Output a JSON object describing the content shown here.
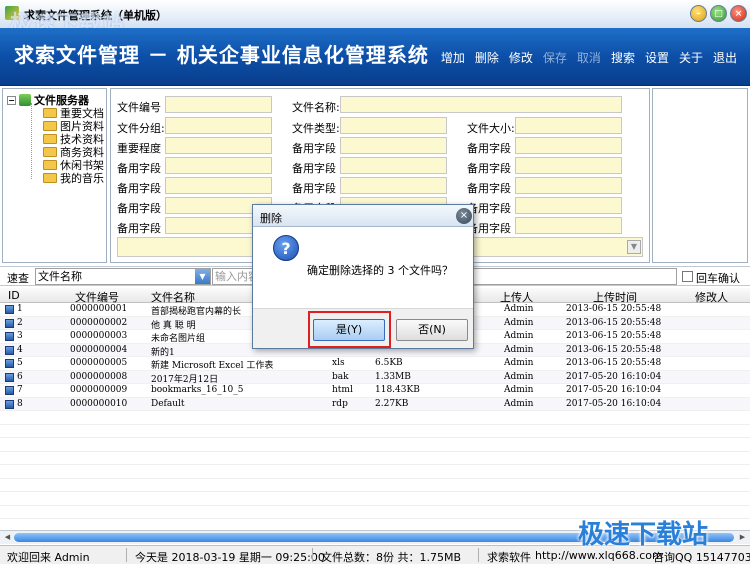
{
  "window": {
    "title": "求索文件管理系统（单机版）"
  },
  "banner": {
    "title": "求索文件管理 － 机关企事业信息化管理系统"
  },
  "toolbar": {
    "add": "增加",
    "delete": "删除",
    "edit": "修改",
    "save": "保存",
    "cancel": "取消",
    "search": "搜索",
    "settings": "设置",
    "about": "关于",
    "exit": "退出"
  },
  "tree": {
    "root": "文件服务器",
    "items": [
      "重要文档",
      "图片资料",
      "技术资料",
      "商务资料",
      "休闲书架",
      "我的音乐"
    ]
  },
  "form": {
    "file_no": "文件编号",
    "file_name": "文件名称:",
    "file_group": "文件分组:",
    "file_type": "文件类型:",
    "file_size": "文件大小:",
    "importance": "重要程度",
    "reserved": "备用字段"
  },
  "search": {
    "label": "速查",
    "field": "文件名称",
    "placeholder": "输入内容",
    "enter_confirm": "回车确认"
  },
  "table": {
    "headers": [
      "ID",
      "文件编号",
      "文件名称",
      "上传人",
      "上传时间",
      "修改人"
    ],
    "rows": [
      {
        "id": "1",
        "no": "0000000001",
        "name": "首部揭秘跑官内幕的长",
        "type": "",
        "size": "",
        "uploader": "Admin",
        "time": "2013-06-15 20:55:48"
      },
      {
        "id": "2",
        "no": "0000000002",
        "name": "他 真 聪 明",
        "type": "",
        "size": "",
        "uploader": "Admin",
        "time": "2013-06-15 20:55:48"
      },
      {
        "id": "3",
        "no": "0000000003",
        "name": "未命名图片组",
        "type": "",
        "size": "",
        "uploader": "Admin",
        "time": "2013-06-15 20:55:48"
      },
      {
        "id": "4",
        "no": "0000000004",
        "name": "新的1",
        "type": "",
        "size": "",
        "uploader": "Admin",
        "time": "2013-06-15 20:55:48"
      },
      {
        "id": "5",
        "no": "0000000005",
        "name": "新建 Microsoft Excel 工作表",
        "type": "xls",
        "size": "6.5KB",
        "uploader": "Admin",
        "time": "2013-06-15 20:55:48"
      },
      {
        "id": "6",
        "no": "0000000008",
        "name": "2017年2月12日",
        "type": "bak",
        "size": "1.33MB",
        "uploader": "Admin",
        "time": "2017-05-20 16:10:04"
      },
      {
        "id": "7",
        "no": "0000000009",
        "name": "bookmarks_16_10_5",
        "type": "html",
        "size": "118.43KB",
        "uploader": "Admin",
        "time": "2017-05-20 16:10:04"
      },
      {
        "id": "8",
        "no": "0000000010",
        "name": "Default",
        "type": "rdp",
        "size": "2.27KB",
        "uploader": "Admin",
        "time": "2017-05-20 16:10:04"
      }
    ]
  },
  "status": {
    "welcome": "欢迎回来 Admin",
    "today": "今天是 2018-03-19 星期一 09:25:00",
    "totals": "文件总数：8份 共：1.75MB",
    "brand": "求索软件",
    "url": "http://www.xlq668.com",
    "qq": "咨询QQ 151477039"
  },
  "dialog": {
    "title": "删除",
    "message": "确定删除选择的 3 个文件吗？",
    "yes": "是(Y)",
    "no": "否(N)",
    "icon": "question-icon"
  },
  "watermark": {
    "top": "极速下载站",
    "bottom": "极速下载站"
  }
}
